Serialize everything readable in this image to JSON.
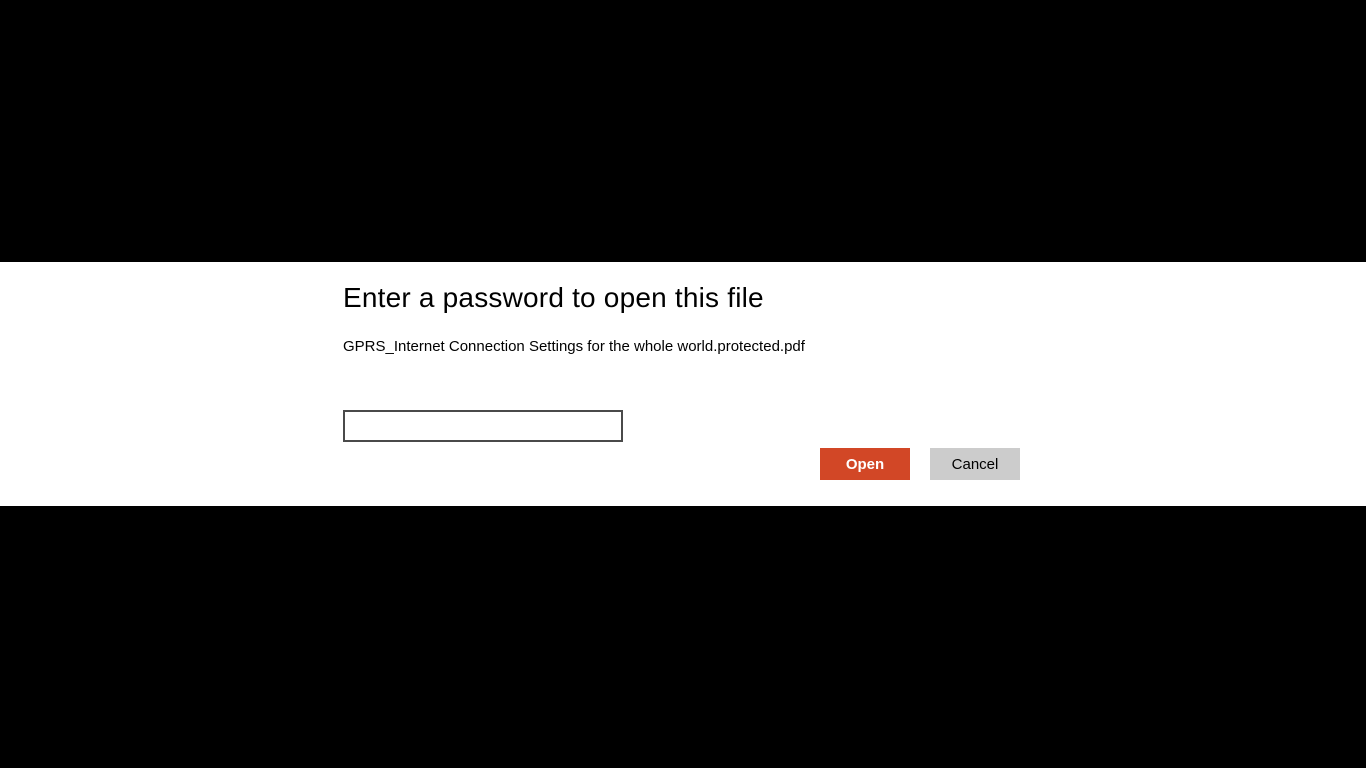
{
  "dialog": {
    "title": "Enter a password to open this file",
    "filename": "GPRS_Internet Connection Settings for the whole world.protected.pdf",
    "password_value": "",
    "buttons": {
      "open": "Open",
      "cancel": "Cancel"
    }
  }
}
